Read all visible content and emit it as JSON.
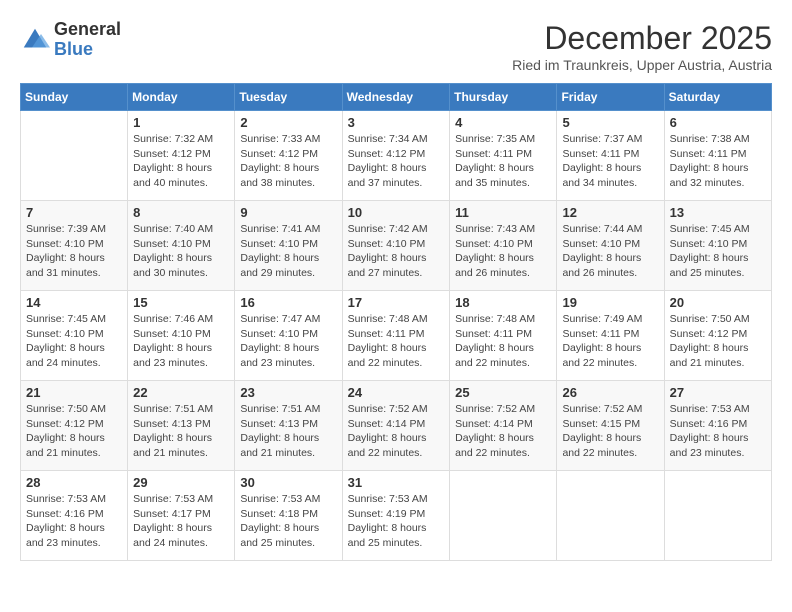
{
  "header": {
    "logo_general": "General",
    "logo_blue": "Blue",
    "month_title": "December 2025",
    "subtitle": "Ried im Traunkreis, Upper Austria, Austria"
  },
  "days_of_week": [
    "Sunday",
    "Monday",
    "Tuesday",
    "Wednesday",
    "Thursday",
    "Friday",
    "Saturday"
  ],
  "weeks": [
    [
      {
        "day": "",
        "info": ""
      },
      {
        "day": "1",
        "info": "Sunrise: 7:32 AM\nSunset: 4:12 PM\nDaylight: 8 hours\nand 40 minutes."
      },
      {
        "day": "2",
        "info": "Sunrise: 7:33 AM\nSunset: 4:12 PM\nDaylight: 8 hours\nand 38 minutes."
      },
      {
        "day": "3",
        "info": "Sunrise: 7:34 AM\nSunset: 4:12 PM\nDaylight: 8 hours\nand 37 minutes."
      },
      {
        "day": "4",
        "info": "Sunrise: 7:35 AM\nSunset: 4:11 PM\nDaylight: 8 hours\nand 35 minutes."
      },
      {
        "day": "5",
        "info": "Sunrise: 7:37 AM\nSunset: 4:11 PM\nDaylight: 8 hours\nand 34 minutes."
      },
      {
        "day": "6",
        "info": "Sunrise: 7:38 AM\nSunset: 4:11 PM\nDaylight: 8 hours\nand 32 minutes."
      }
    ],
    [
      {
        "day": "7",
        "info": "Sunrise: 7:39 AM\nSunset: 4:10 PM\nDaylight: 8 hours\nand 31 minutes."
      },
      {
        "day": "8",
        "info": "Sunrise: 7:40 AM\nSunset: 4:10 PM\nDaylight: 8 hours\nand 30 minutes."
      },
      {
        "day": "9",
        "info": "Sunrise: 7:41 AM\nSunset: 4:10 PM\nDaylight: 8 hours\nand 29 minutes."
      },
      {
        "day": "10",
        "info": "Sunrise: 7:42 AM\nSunset: 4:10 PM\nDaylight: 8 hours\nand 27 minutes."
      },
      {
        "day": "11",
        "info": "Sunrise: 7:43 AM\nSunset: 4:10 PM\nDaylight: 8 hours\nand 26 minutes."
      },
      {
        "day": "12",
        "info": "Sunrise: 7:44 AM\nSunset: 4:10 PM\nDaylight: 8 hours\nand 26 minutes."
      },
      {
        "day": "13",
        "info": "Sunrise: 7:45 AM\nSunset: 4:10 PM\nDaylight: 8 hours\nand 25 minutes."
      }
    ],
    [
      {
        "day": "14",
        "info": "Sunrise: 7:45 AM\nSunset: 4:10 PM\nDaylight: 8 hours\nand 24 minutes."
      },
      {
        "day": "15",
        "info": "Sunrise: 7:46 AM\nSunset: 4:10 PM\nDaylight: 8 hours\nand 23 minutes."
      },
      {
        "day": "16",
        "info": "Sunrise: 7:47 AM\nSunset: 4:10 PM\nDaylight: 8 hours\nand 23 minutes."
      },
      {
        "day": "17",
        "info": "Sunrise: 7:48 AM\nSunset: 4:11 PM\nDaylight: 8 hours\nand 22 minutes."
      },
      {
        "day": "18",
        "info": "Sunrise: 7:48 AM\nSunset: 4:11 PM\nDaylight: 8 hours\nand 22 minutes."
      },
      {
        "day": "19",
        "info": "Sunrise: 7:49 AM\nSunset: 4:11 PM\nDaylight: 8 hours\nand 22 minutes."
      },
      {
        "day": "20",
        "info": "Sunrise: 7:50 AM\nSunset: 4:12 PM\nDaylight: 8 hours\nand 21 minutes."
      }
    ],
    [
      {
        "day": "21",
        "info": "Sunrise: 7:50 AM\nSunset: 4:12 PM\nDaylight: 8 hours\nand 21 minutes."
      },
      {
        "day": "22",
        "info": "Sunrise: 7:51 AM\nSunset: 4:13 PM\nDaylight: 8 hours\nand 21 minutes."
      },
      {
        "day": "23",
        "info": "Sunrise: 7:51 AM\nSunset: 4:13 PM\nDaylight: 8 hours\nand 21 minutes."
      },
      {
        "day": "24",
        "info": "Sunrise: 7:52 AM\nSunset: 4:14 PM\nDaylight: 8 hours\nand 22 minutes."
      },
      {
        "day": "25",
        "info": "Sunrise: 7:52 AM\nSunset: 4:14 PM\nDaylight: 8 hours\nand 22 minutes."
      },
      {
        "day": "26",
        "info": "Sunrise: 7:52 AM\nSunset: 4:15 PM\nDaylight: 8 hours\nand 22 minutes."
      },
      {
        "day": "27",
        "info": "Sunrise: 7:53 AM\nSunset: 4:16 PM\nDaylight: 8 hours\nand 23 minutes."
      }
    ],
    [
      {
        "day": "28",
        "info": "Sunrise: 7:53 AM\nSunset: 4:16 PM\nDaylight: 8 hours\nand 23 minutes."
      },
      {
        "day": "29",
        "info": "Sunrise: 7:53 AM\nSunset: 4:17 PM\nDaylight: 8 hours\nand 24 minutes."
      },
      {
        "day": "30",
        "info": "Sunrise: 7:53 AM\nSunset: 4:18 PM\nDaylight: 8 hours\nand 25 minutes."
      },
      {
        "day": "31",
        "info": "Sunrise: 7:53 AM\nSunset: 4:19 PM\nDaylight: 8 hours\nand 25 minutes."
      },
      {
        "day": "",
        "info": ""
      },
      {
        "day": "",
        "info": ""
      },
      {
        "day": "",
        "info": ""
      }
    ]
  ]
}
